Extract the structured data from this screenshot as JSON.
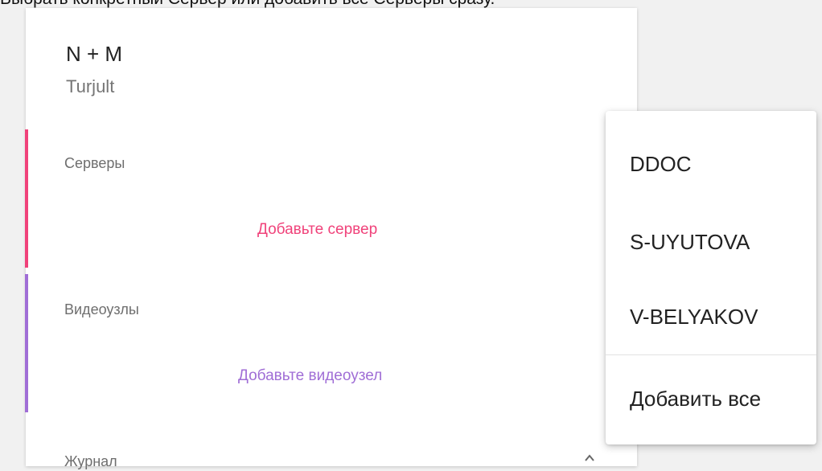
{
  "caption": "Выбрать конкретный Сервер или добавить все Серверы сразу.",
  "header": {
    "title": "N + M",
    "subtitle": "Turjult"
  },
  "sections": {
    "servers": {
      "label": "Серверы",
      "action": "Добавьте сервер",
      "color": "#f0427a"
    },
    "video_nodes": {
      "label": "Видеоузлы",
      "action": "Добавьте видеоузел",
      "color": "#a06ed6"
    },
    "journal": {
      "label": "Журнал"
    }
  },
  "icons": {
    "journal_toggle": "chevron-up-icon"
  },
  "menu": {
    "items": [
      "DDOC",
      "S-UYUTOVA",
      "V-BELYAKOV"
    ],
    "add_all": "Добавить все"
  }
}
